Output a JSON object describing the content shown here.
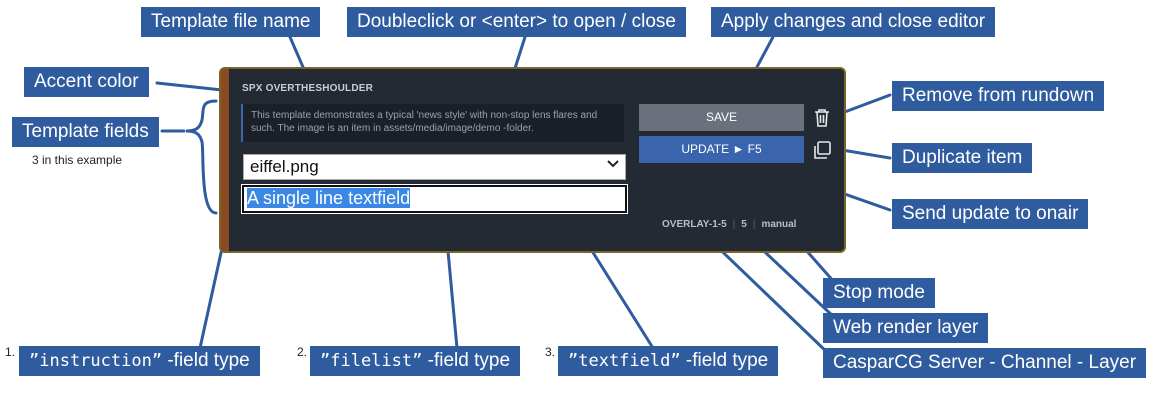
{
  "callouts": {
    "template_file_name": "Template file name",
    "doubleclick": "Doubleclick or <enter>  to open / close",
    "apply_changes": "Apply changes and close editor",
    "accent_color": "Accent color",
    "template_fields": "Template fields",
    "template_fields_note": "3 in this example",
    "remove": "Remove from rundown",
    "duplicate": "Duplicate item",
    "send_update": "Send update to onair",
    "stop_mode": "Stop mode",
    "web_render_layer": "Web render layer",
    "casparcg": "CasparCG Server - Channel - Layer",
    "instruction_type": {
      "num": "1.",
      "code": "”instruction”",
      "suffix": " -field type"
    },
    "filelist_type": {
      "num": "2.",
      "code": "”filelist”",
      "suffix": " -field type"
    },
    "textfield_type": {
      "num": "3.",
      "code": "”textfield”",
      "suffix": " -field type"
    }
  },
  "panel": {
    "template_name": "SPX OVERTHESHOULDER",
    "instruction_text": "This template demonstrates a typical 'news style' with non-stop lens flares and such. The image is an item in assets/media/image/demo -folder.",
    "filelist_value": "eiffel.png",
    "textfield_value": "A single line textfield",
    "save_label": "SAVE",
    "update_label": "UPDATE ► F5",
    "channel_layer": "OVERLAY-1-5",
    "web_layer": "5",
    "stop_mode": "manual"
  },
  "colors": {
    "callout_bg": "#2f5c9e",
    "panel_bg": "#242a33",
    "accent": "#8a4b22",
    "update_button": "#3a64ad",
    "save_button": "#6a717c"
  },
  "icons": {
    "remove": "trash-icon",
    "duplicate": "copy-icon"
  }
}
